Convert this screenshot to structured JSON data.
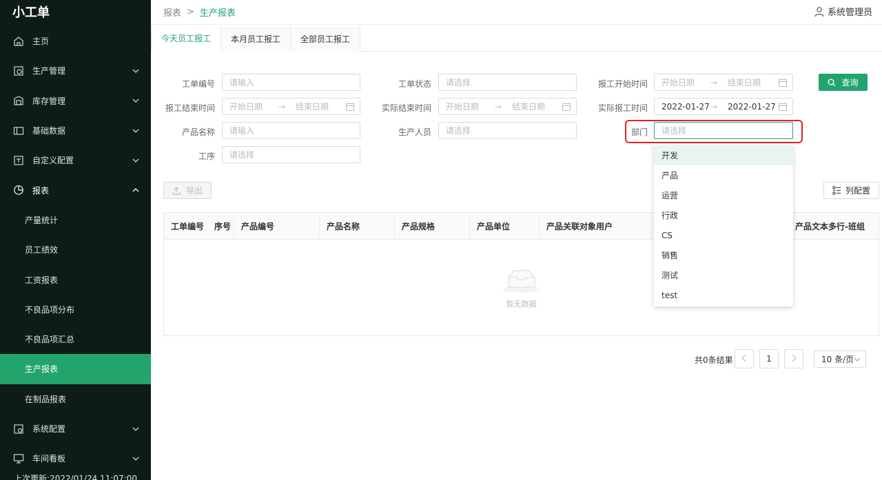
{
  "app": {
    "logo": "小工单",
    "footer": "上次更新:2022/01/24 11:07:00"
  },
  "sidebar": {
    "items": [
      {
        "label": "主页",
        "icon": "home-icon",
        "has_children": false,
        "expanded": false
      },
      {
        "label": "生产管理",
        "icon": "production-icon",
        "has_children": true,
        "expanded": false
      },
      {
        "label": "库存管理",
        "icon": "inventory-icon",
        "has_children": true,
        "expanded": false
      },
      {
        "label": "基础数据",
        "icon": "data-icon",
        "has_children": true,
        "expanded": false
      },
      {
        "label": "自定义配置",
        "icon": "custom-config-icon",
        "has_children": true,
        "expanded": false
      },
      {
        "label": "报表",
        "icon": "report-icon",
        "has_children": true,
        "expanded": true
      },
      {
        "label": "系统配置",
        "icon": "system-config-icon",
        "has_children": true,
        "expanded": false
      },
      {
        "label": "车间看板",
        "icon": "workshop-board-icon",
        "has_children": true,
        "expanded": false
      }
    ],
    "report_children": [
      {
        "label": "产量统计",
        "active": false
      },
      {
        "label": "员工绩效",
        "active": false
      },
      {
        "label": "工资报表",
        "active": false
      },
      {
        "label": "不良品项分布",
        "active": false
      },
      {
        "label": "不良品项汇总",
        "active": false
      },
      {
        "label": "生产报表",
        "active": true
      },
      {
        "label": "在制品报表",
        "active": false
      }
    ]
  },
  "header": {
    "breadcrumb": [
      "报表",
      "生产报表"
    ],
    "breadcrumb_sep": ">",
    "user": "系统管理员"
  },
  "tabs": [
    {
      "label": "今天员工报工",
      "active": true
    },
    {
      "label": "本月员工报工",
      "active": false
    },
    {
      "label": "全部员工报工",
      "active": false
    }
  ],
  "form": {
    "work_order_no": {
      "label": "工单编号",
      "placeholder": "请输入"
    },
    "work_order_status": {
      "label": "工单状态",
      "placeholder": "请选择"
    },
    "report_start_time": {
      "label": "报工开始时间",
      "start_placeholder": "开始日期",
      "end_placeholder": "结束日期"
    },
    "report_end_time": {
      "label": "报工结束时间",
      "start_placeholder": "开始日期",
      "end_placeholder": "结束日期"
    },
    "actual_end_time": {
      "label": "实际结束时间",
      "start_placeholder": "开始日期",
      "end_placeholder": "结束日期"
    },
    "actual_report_time": {
      "label": "实际报工时间",
      "start": "2022-01-27",
      "end": "2022-01-27"
    },
    "product_name": {
      "label": "产品名称",
      "placeholder": "请输入"
    },
    "producer": {
      "label": "生产人员",
      "placeholder": "请选择"
    },
    "department": {
      "label": "部门",
      "placeholder": "请选择"
    },
    "process": {
      "label": "工序",
      "placeholder": "请选择"
    },
    "range_arrow": "→",
    "search_label": "查询"
  },
  "toolbar": {
    "export_label": "导出",
    "column_config_label": "列配置"
  },
  "table": {
    "columns": [
      "工单编号",
      "序号",
      "产品编号",
      "产品名称",
      "产品规格",
      "产品单位",
      "产品关联对象用户",
      "产品文本多行-班组"
    ],
    "empty_text": "暂无数据"
  },
  "pagination": {
    "total_text": "共0条结果",
    "current_page": "1",
    "page_size": "10 条/页",
    "prev": "<",
    "next": ">"
  },
  "department_dropdown": {
    "options": [
      "开发",
      "产品",
      "运营",
      "行政",
      "CS",
      "销售",
      "测试",
      "test"
    ],
    "hovered_index": 0
  },
  "colors": {
    "accent": "#24a46d",
    "sidebar_bg": "#0d1d15",
    "highlight": "#e02020"
  }
}
